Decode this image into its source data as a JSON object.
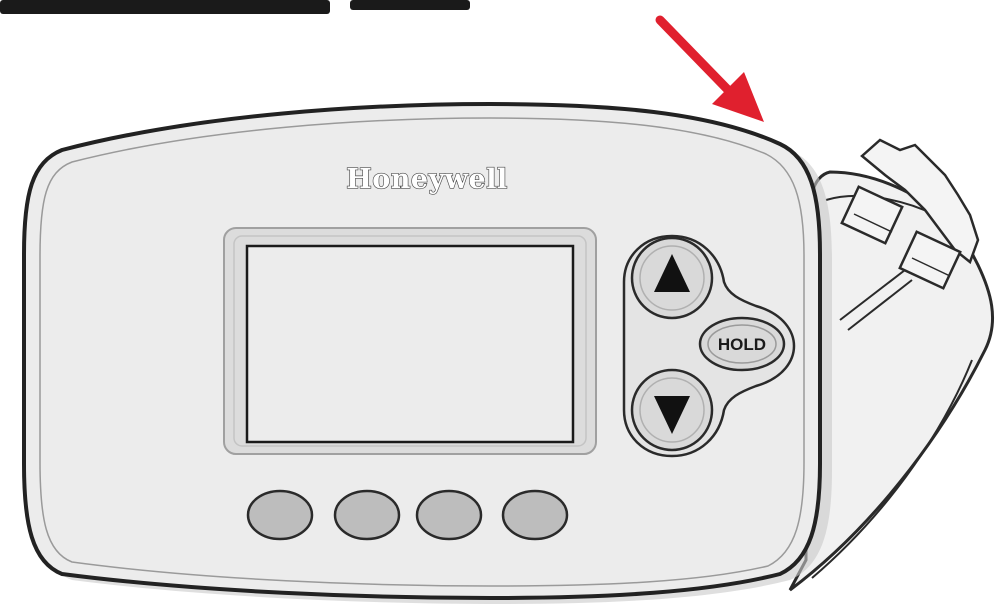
{
  "device": {
    "brand": "Honeywell",
    "hold_label": "HOLD",
    "display_text": ""
  },
  "icons": {
    "up": "up-arrow-icon",
    "down": "down-arrow-icon",
    "pointer": "red-arrow-icon"
  },
  "colors": {
    "pointer": "#e0202e",
    "body": "#ececec",
    "outline": "#2a2a2a",
    "soft_keys": "#bdbdbd"
  }
}
